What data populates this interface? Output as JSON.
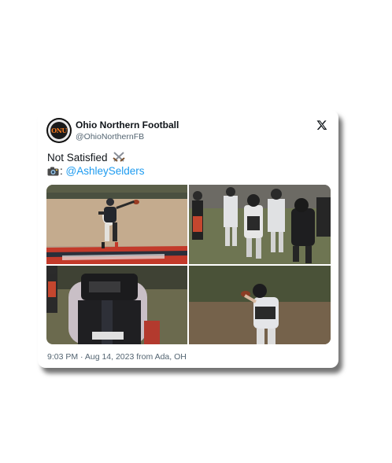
{
  "tweet": {
    "display_name": "Ohio Northern Football",
    "handle": "@OhioNorthernFB",
    "text_line1": "Not Satisfied",
    "text_line2_prefix": ":",
    "mention": "@AshleySelders",
    "timestamp": "9:03 PM · Aug 14, 2023 from Ada, OH",
    "avatar_text": "ONU",
    "photo_captions": [
      "",
      "",
      "",
      ""
    ]
  },
  "icons": {
    "platform": "x-logo-icon",
    "emoji_1": "crossed-swords-icon",
    "emoji_2": "camera-icon"
  },
  "colors": {
    "link": "#1d9bf0",
    "text": "#0f1419",
    "muted": "#536471",
    "brand_orange": "#f47a20"
  }
}
